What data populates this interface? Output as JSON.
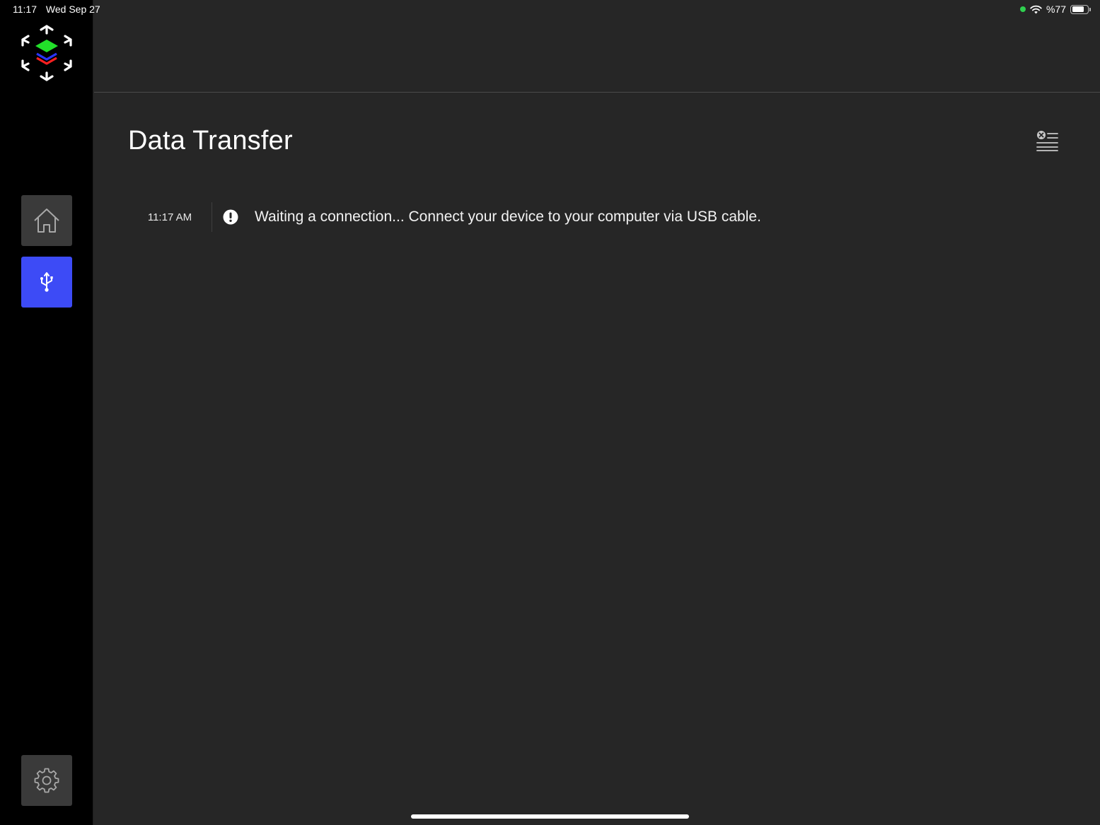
{
  "status_bar": {
    "time": "11:17",
    "date": "Wed Sep 27",
    "battery_text": "%77",
    "battery_level": 0.77
  },
  "sidebar": {
    "logo_icon": "layers-cube-logo-icon",
    "items": [
      {
        "id": "home",
        "icon": "home-icon",
        "active": false
      },
      {
        "id": "data-transfer",
        "icon": "usb-icon",
        "active": true
      },
      {
        "id": "settings",
        "icon": "gear-icon",
        "active": false
      }
    ],
    "active_color": "#3d4bf6"
  },
  "page": {
    "title": "Data Transfer",
    "clear_icon": "clear-log-icon"
  },
  "log": [
    {
      "time": "11:17 AM",
      "icon": "alert-icon",
      "message": "Waiting a connection... Connect your device to your computer via USB cable."
    }
  ]
}
